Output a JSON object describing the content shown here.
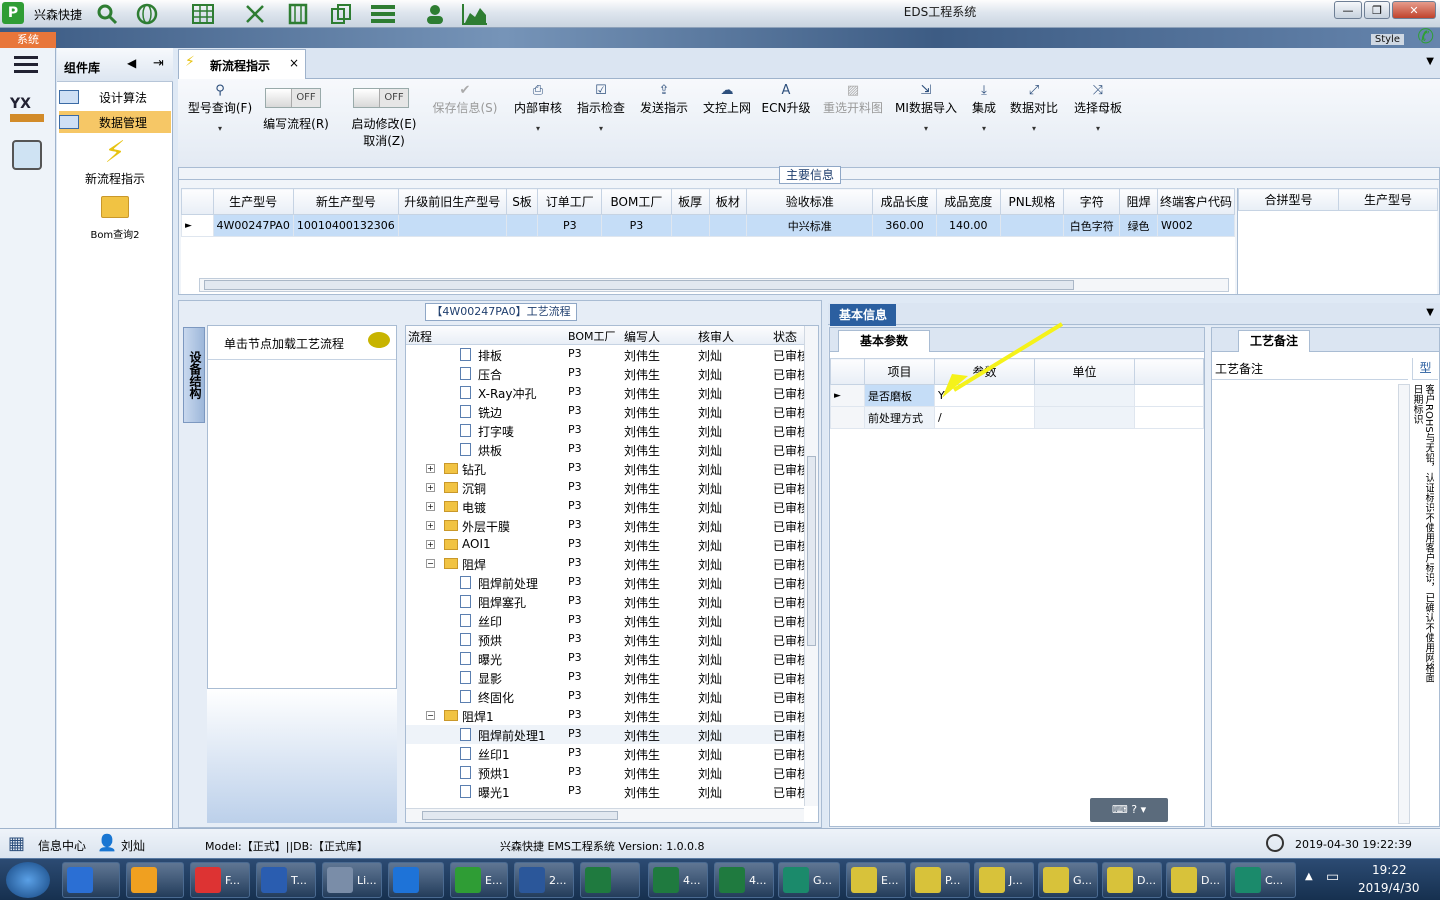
{
  "app": {
    "name": "兴森快捷",
    "window_title": "EDS工程系统",
    "style_label": "Style",
    "system_tab": "系统"
  },
  "sidebar": {
    "header": "组件库",
    "items": [
      {
        "label": "设计算法"
      },
      {
        "label": "数据管理"
      }
    ],
    "launchers": [
      {
        "label": "新流程指示"
      },
      {
        "label": "Bom查询2"
      }
    ]
  },
  "doc_tab": {
    "label": "新流程指示",
    "close": "×"
  },
  "ribbon": {
    "query": "型号查询(F)",
    "edit_flow": "编写流程(R)",
    "edit_flow_state": "OFF",
    "start_edit": "启动修改(E)",
    "start_edit_state": "OFF",
    "cancel": "取消(Z)",
    "save": "保存信息(S)",
    "internal_review": "内部审核",
    "check": "指示检查",
    "send": "发送指示",
    "upload": "文控上网",
    "ecn": "ECN升级",
    "reselect": "重选开料图",
    "mi_import": "MI数据导入",
    "integrate": "集成",
    "compare": "数据对比",
    "select_mother": "选择母板"
  },
  "main_info": {
    "title": "主要信息",
    "columns": [
      "生产型号",
      "新生产型号",
      "升级前旧生产型号",
      "S板",
      "订单工厂",
      "BOM工厂",
      "板厚",
      "板材",
      "验收标准",
      "成品长度",
      "成品宽度",
      "PNL规格",
      "字符",
      "阻焊",
      "终端客户代码"
    ],
    "row": [
      "4W00247PA0",
      "10010400132306",
      "",
      "",
      "P3",
      "P3",
      "",
      "",
      "中兴标准",
      "360.00",
      "140.00",
      "",
      "白色字符",
      "绿色",
      "W002"
    ],
    "side_columns": [
      "合拼型号",
      "生产型号"
    ]
  },
  "process": {
    "title": "【4W00247PA0】工艺流程",
    "device_tab": "设备结构",
    "hint": "单击节点加载工艺流程",
    "columns": [
      "流程",
      "BOM工厂",
      "编写人",
      "核审人",
      "状态"
    ],
    "rows": [
      {
        "name": "排板",
        "t": "doc",
        "lvl": 2,
        "bom": "P3",
        "writer": "刘伟生",
        "reviewer": "刘灿",
        "status": "已审核"
      },
      {
        "name": "压合",
        "t": "doc",
        "lvl": 2,
        "bom": "P3",
        "writer": "刘伟生",
        "reviewer": "刘灿",
        "status": "已审核"
      },
      {
        "name": "X-Ray冲孔",
        "t": "doc",
        "lvl": 2,
        "bom": "P3",
        "writer": "刘伟生",
        "reviewer": "刘灿",
        "status": "已审核"
      },
      {
        "name": "铣边",
        "t": "doc",
        "lvl": 2,
        "bom": "P3",
        "writer": "刘伟生",
        "reviewer": "刘灿",
        "status": "已审核"
      },
      {
        "name": "打字唛",
        "t": "doc",
        "lvl": 2,
        "bom": "P3",
        "writer": "刘伟生",
        "reviewer": "刘灿",
        "status": "已审核"
      },
      {
        "name": "烘板",
        "t": "doc",
        "lvl": 2,
        "bom": "P3",
        "writer": "刘伟生",
        "reviewer": "刘灿",
        "status": "已审核"
      },
      {
        "name": "钻孔",
        "t": "fold",
        "lvl": 1,
        "bom": "P3",
        "writer": "刘伟生",
        "reviewer": "刘灿",
        "status": "已审核"
      },
      {
        "name": "沉铜",
        "t": "fold",
        "lvl": 1,
        "bom": "P3",
        "writer": "刘伟生",
        "reviewer": "刘灿",
        "status": "已审核"
      },
      {
        "name": "电镀",
        "t": "fold",
        "lvl": 1,
        "bom": "P3",
        "writer": "刘伟生",
        "reviewer": "刘灿",
        "status": "已审核"
      },
      {
        "name": "外层干膜",
        "t": "fold",
        "lvl": 1,
        "bom": "P3",
        "writer": "刘伟生",
        "reviewer": "刘灿",
        "status": "已审核"
      },
      {
        "name": "AOI1",
        "t": "fold",
        "lvl": 1,
        "bom": "P3",
        "writer": "刘伟生",
        "reviewer": "刘灿",
        "status": "已审核"
      },
      {
        "name": "阻焊",
        "t": "open",
        "lvl": 1,
        "bom": "P3",
        "writer": "刘伟生",
        "reviewer": "刘灿",
        "status": "已审核"
      },
      {
        "name": "阻焊前处理",
        "t": "doc",
        "lvl": 2,
        "bom": "P3",
        "writer": "刘伟生",
        "reviewer": "刘灿",
        "status": "已审核"
      },
      {
        "name": "阻焊塞孔",
        "t": "doc",
        "lvl": 2,
        "bom": "P3",
        "writer": "刘伟生",
        "reviewer": "刘灿",
        "status": "已审核"
      },
      {
        "name": "丝印",
        "t": "doc",
        "lvl": 2,
        "bom": "P3",
        "writer": "刘伟生",
        "reviewer": "刘灿",
        "status": "已审核"
      },
      {
        "name": "预烘",
        "t": "doc",
        "lvl": 2,
        "bom": "P3",
        "writer": "刘伟生",
        "reviewer": "刘灿",
        "status": "已审核"
      },
      {
        "name": "曝光",
        "t": "doc",
        "lvl": 2,
        "bom": "P3",
        "writer": "刘伟生",
        "reviewer": "刘灿",
        "status": "已审核"
      },
      {
        "name": "显影",
        "t": "doc",
        "lvl": 2,
        "bom": "P3",
        "writer": "刘伟生",
        "reviewer": "刘灿",
        "status": "已审核"
      },
      {
        "name": "终固化",
        "t": "doc",
        "lvl": 2,
        "bom": "P3",
        "writer": "刘伟生",
        "reviewer": "刘灿",
        "status": "已审核"
      },
      {
        "name": "阻焊1",
        "t": "open",
        "lvl": 1,
        "bom": "P3",
        "writer": "刘伟生",
        "reviewer": "刘灿",
        "status": "已审核"
      },
      {
        "name": "阻焊前处理1",
        "t": "doc",
        "lvl": 2,
        "bom": "P3",
        "writer": "刘伟生",
        "reviewer": "刘灿",
        "status": "已审核"
      },
      {
        "name": "丝印1",
        "t": "doc",
        "lvl": 2,
        "bom": "P3",
        "writer": "刘伟生",
        "reviewer": "刘灿",
        "status": "已审核"
      },
      {
        "name": "预烘1",
        "t": "doc",
        "lvl": 2,
        "bom": "P3",
        "writer": "刘伟生",
        "reviewer": "刘灿",
        "status": "已审核"
      },
      {
        "name": "曝光1",
        "t": "doc",
        "lvl": 2,
        "bom": "P3",
        "writer": "刘伟生",
        "reviewer": "刘灿",
        "status": "已审核"
      }
    ]
  },
  "basic_info": {
    "tab": "基本信息",
    "subtab": "基本参数",
    "columns": [
      "项目",
      "参数",
      "单位"
    ],
    "rows": [
      {
        "item": "是否磨板",
        "param": "Y",
        "unit": ""
      },
      {
        "item": "前处理方式",
        "param": "/",
        "unit": ""
      }
    ],
    "note_tab": "工艺备注",
    "note_column": "工艺备注",
    "note_side_header": "型",
    "note_side_text": "客户ROHS与无铅，认证标识不使用客户标识，已确认不使用网格面日期标识"
  },
  "status": {
    "info_center": "信息中心",
    "user": "刘灿",
    "model": "Model:【正式】||DB:【正式库】",
    "version": "兴森快捷 EMS工程系统 Version: 1.0.0.8",
    "datetime": "2019-04-30 19:22:39"
  },
  "taskbar": {
    "items": [
      "F...",
      "T...",
      "Li...",
      "",
      "E...",
      "2...",
      "",
      "4...",
      "4...",
      "G...",
      "E...",
      "P...",
      "J...",
      "G...",
      "D...",
      "D...",
      "C..."
    ],
    "time": "19:22",
    "date": "2019/4/30"
  },
  "colors": {
    "accent": "#2b5fa0",
    "selected_row": "#c5ddf7",
    "arrow": "#f5f21a",
    "folder": "#f1c343"
  }
}
